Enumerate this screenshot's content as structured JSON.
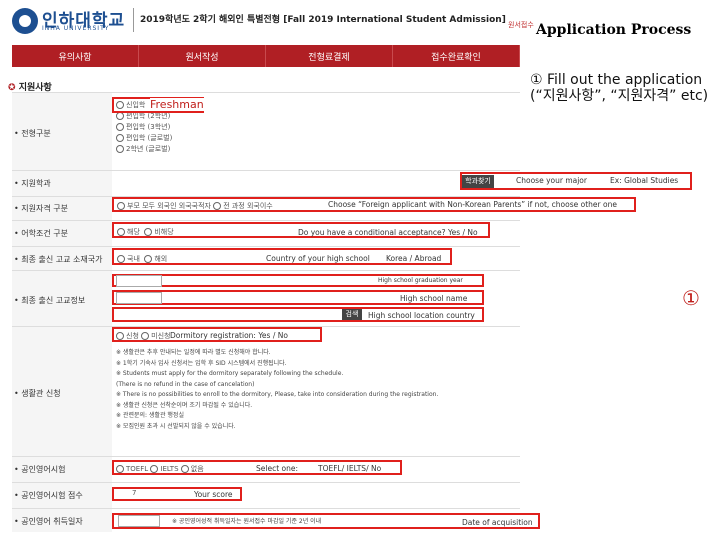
{
  "header": {
    "logo_ko": "인하대학교",
    "logo_en": "INHA UNIVERSITY",
    "title": "2019학년도 2학기 해외인 특별전형 [Fall 2019 International Student Admission]",
    "right_text": "원서접수"
  },
  "slide_title": "Application Process",
  "nav": [
    "유의사항",
    "원서작성",
    "전형료결제",
    "접수완료확인"
  ],
  "section_title": "지원사항",
  "step_text": "① Fill out the application (“지원사항”, “지원자격” etc)",
  "rows": {
    "admission_type": "전형구분",
    "major": "지원학과",
    "qualification": "지원자격 구분",
    "conditional": "어학조건 구분",
    "country": "최종 출신 고교 소재국가",
    "highschool": "최종 출신 고교정보",
    "dormitory": "생활관 신청",
    "language_test": "공인영어시험",
    "score": "공인영어시험 점수",
    "acquired_date": "공인영어 취득일자"
  },
  "admission_options": [
    "신입학",
    "편입학 (2학년)",
    "편입학 (3학년)",
    "편입학 (글로벌)",
    "2학년 (글로벌)"
  ],
  "annotations": {
    "freshman": "Freshman",
    "major_btn": "학과찾기",
    "major_hint": "Choose your major",
    "major_ex": "Ex: Global Studies",
    "qualification_hint": "Choose “Foreign applicant with Non-Korean Parents” if not, choose other one",
    "conditional_hint": "Do you have a conditional acceptance? Yes / No",
    "country_hint": "Country of your high school",
    "country_opts": "Korea / Abroad",
    "grad_year": "High school graduation year",
    "hs_name": "High school name",
    "search_btn": "검색",
    "hs_country": "High school location country",
    "dorm": "Dormitory registration: Yes / No",
    "select_one": "Select one:",
    "test_opts": "TOEFL/ IELTS/ No",
    "score_hint": "Your score",
    "date_hint": "Date of acquisition"
  },
  "radio_labels": {
    "qualification": "부모 모두 외국인 외국국적자",
    "qualification_2": "전 과정 외국이수",
    "cond_yes": "해당",
    "cond_no": "비해당",
    "country_ko": "국내",
    "country_abroad": "해외",
    "dorm_yes": "신청",
    "dorm_no": "미신청",
    "toefl": "TOEFL",
    "ielts": "IELTS",
    "none": "없음"
  },
  "dorm_notes": [
    "※ 생활관은 추후 안내되는 일정에 따라 별도 신청해야 합니다.",
    "※ 1학기 기숙사 입사 신청서는 입학 후 SID 시스템에서 진행됩니다.",
    "※ Students must apply for the dormitory separately following the schedule.",
    "(There is no refund in the case of cancelation)",
    "※ There is no possibilities to enroll to the dormitory, Please, take into consideration during the registration.",
    "※ 생활관 신청은 선착순이며 조기 마감될 수 있습니다.",
    "※ 관련문의: 생활관 행정실",
    "※ 모집인원 초과 시 선발되지 않을 수 있습니다."
  ],
  "score_value": "7",
  "date_note": "※ 공인영어성적 취득일자는 원서접수 마감일 기준 2년 이내",
  "big_marker": "①",
  "colors": {
    "nav": "#b01f24",
    "highlight": "#e0201c"
  }
}
